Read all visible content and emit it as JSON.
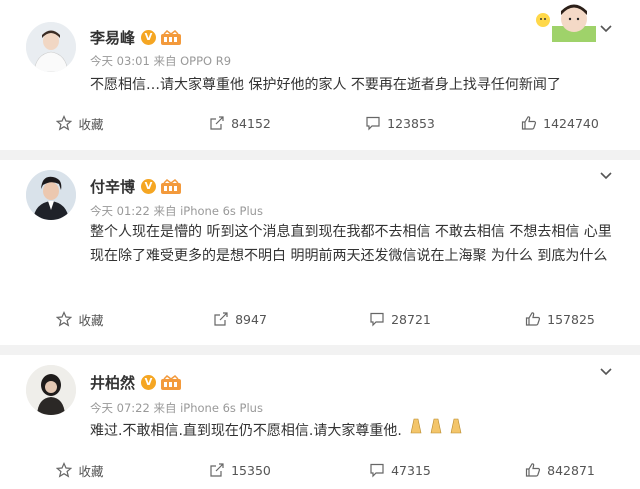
{
  "posts": [
    {
      "name": "李易峰",
      "verified_badge": "V",
      "meta": "今天 03:01 来自 OPPO R9",
      "content": "不愿相信…请大家尊重他 保护好他的家人 不要再在逝者身上找寻任何新闻了",
      "favorite_label": "收藏",
      "repost_count": "84152",
      "comment_count": "123853",
      "like_count": "1424740"
    },
    {
      "name": "付辛博",
      "verified_badge": "V",
      "meta": "今天 01:22 来自 iPhone 6s Plus",
      "content": "整个人现在是懵的 听到这个消息直到现在我都不去相信 不敢去相信 不想去相信 心里现在除了难受更多的是想不明白 明明前两天还发微信说在上海聚 为什么 到底为什么",
      "favorite_label": "收藏",
      "repost_count": "8947",
      "comment_count": "28721",
      "like_count": "157825"
    },
    {
      "name": "井柏然",
      "verified_badge": "V",
      "meta": "今天 07:22 来自 iPhone 6s Plus",
      "content": "难过.不敢相信.直到现在仍不愿相信.请大家尊重他.",
      "favorite_label": "收藏",
      "repost_count": "15350",
      "comment_count": "47315",
      "like_count": "842871"
    }
  ],
  "icons": {
    "favorite": "star-outline-icon",
    "repost": "share-arrow-icon",
    "comment": "speech-bubble-icon",
    "like": "thumbs-up-icon",
    "more": "chevron-down-icon"
  },
  "colors": {
    "verified": "#f5a623",
    "text": "#333333",
    "meta": "#999999",
    "divider": "#f2f2f2"
  }
}
